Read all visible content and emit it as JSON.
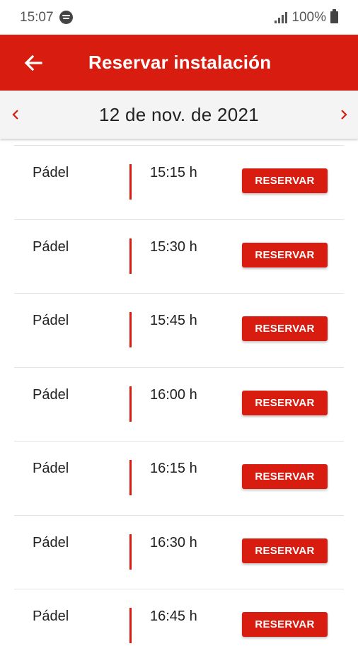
{
  "status_bar": {
    "time": "15:07",
    "battery": "100%"
  },
  "app_bar": {
    "title": "Reservar instalación",
    "back_icon": "arrow-left-icon"
  },
  "date_nav": {
    "date": "12 de nov. de 2021",
    "prev_icon": "chevron-left-icon",
    "next_icon": "chevron-right-icon"
  },
  "slots": [
    {
      "sport": "Pádel",
      "time": "15:15 h",
      "button": "RESERVAR"
    },
    {
      "sport": "Pádel",
      "time": "15:30 h",
      "button": "RESERVAR"
    },
    {
      "sport": "Pádel",
      "time": "15:45 h",
      "button": "RESERVAR"
    },
    {
      "sport": "Pádel",
      "time": "16:00 h",
      "button": "RESERVAR"
    },
    {
      "sport": "Pádel",
      "time": "16:15 h",
      "button": "RESERVAR"
    },
    {
      "sport": "Pádel",
      "time": "16:30 h",
      "button": "RESERVAR"
    },
    {
      "sport": "Pádel",
      "time": "16:45 h",
      "button": "RESERVAR"
    }
  ],
  "colors": {
    "accent": "#d91c10",
    "date_bar_bg": "#f4f4f4"
  }
}
